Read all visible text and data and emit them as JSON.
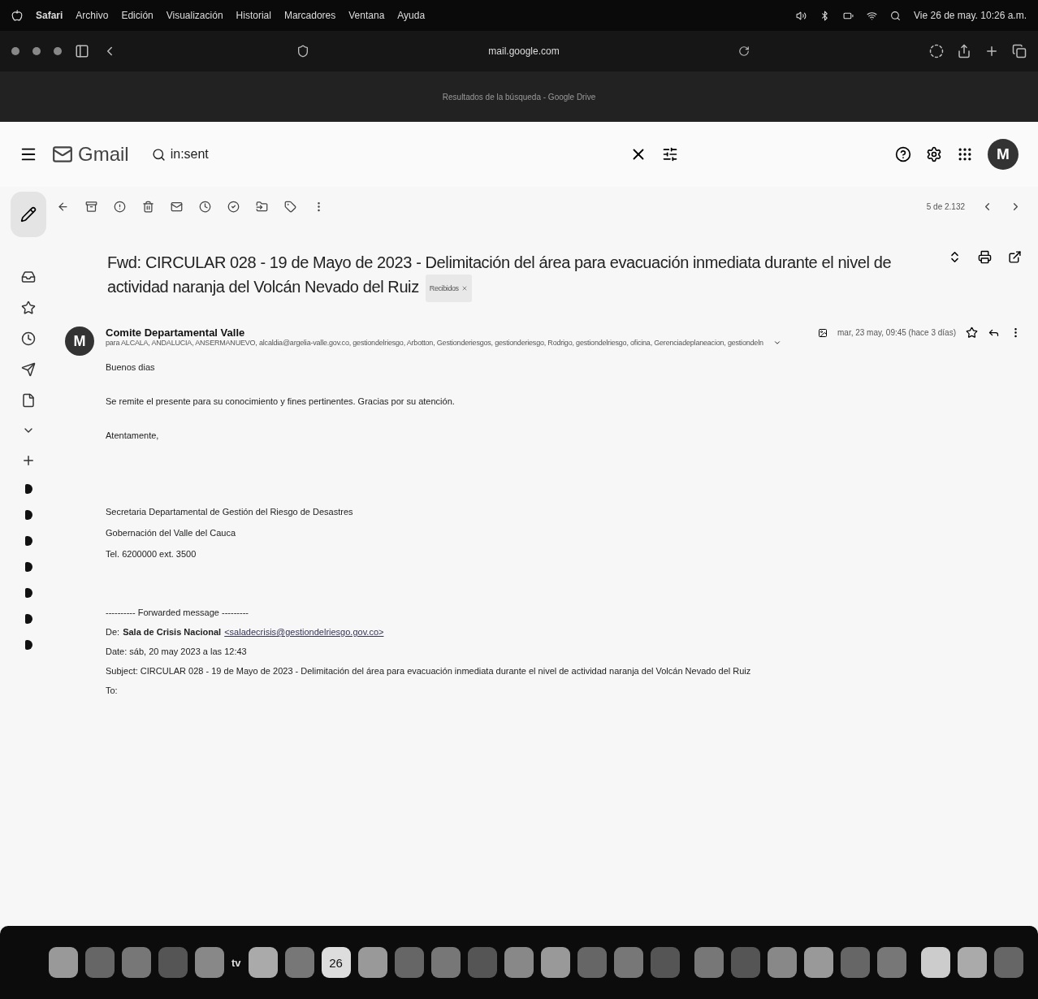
{
  "menubar": {
    "app": "Safari",
    "items": [
      "Archivo",
      "Edición",
      "Visualización",
      "Historial",
      "Marcadores",
      "Ventana",
      "Ayuda"
    ],
    "clock": "Vie 26 de may. 10:26 a.m."
  },
  "browser": {
    "url": "mail.google.com",
    "tab_title": "Resultados de la búsqueda - Google Drive"
  },
  "gmail": {
    "product": "Gmail",
    "search_value": "in:sent",
    "avatar_letter": "M",
    "pagination": "5 de 2.132"
  },
  "email": {
    "subject": "Fwd: CIRCULAR 028 - 19 de Mayo de 2023 - Delimitación del área para evacuación inmediata durante el nivel de actividad naranja del Volcán Nevado del Ruiz",
    "label": "Recibidos",
    "sender": "Comite Departamental Valle",
    "sender_avatar": "M",
    "date": "mar, 23 may, 09:45 (hace 3 días)",
    "recipients": "para ALCALA, ANDALUCIA, ANSERMANUEVO, alcaldia@argelia-valle.gov.co, gestiondelriesgo, Arbotton, Gestionderiesgos, gestionderiesgo, Rodrigo, gestiondelriesgo, oficina, Gerenciadeplaneacion, gestiondeln",
    "body": [
      "Buenos dias",
      "Se remite el presente para su conocimiento y fines pertinentes. Gracias por su atención.",
      "Atentamente,"
    ],
    "signature": [
      "Secretaria Departamental de Gestión del Riesgo de Desastres",
      "Gobernación del Valle del Cauca",
      "Tel. 6200000 ext. 3500"
    ],
    "forwarded": {
      "header": "---------- Forwarded message ---------",
      "from_label": "De:",
      "from_name": "Sala de Crisis Nacional",
      "from_email": "<saladecrisis@gestiondelriesgo.gov.co>",
      "date_line": "Date: sáb, 20 may 2023 a las 12:43",
      "subject_line": "Subject: CIRCULAR 028 - 19 de Mayo de 2023 - Delimitación del área para evacuación inmediata durante el nivel de actividad naranja del Volcán Nevado del Ruiz",
      "to_line": "To:"
    }
  },
  "dock": {
    "calendar_day": "26",
    "tv_label": "tv"
  }
}
